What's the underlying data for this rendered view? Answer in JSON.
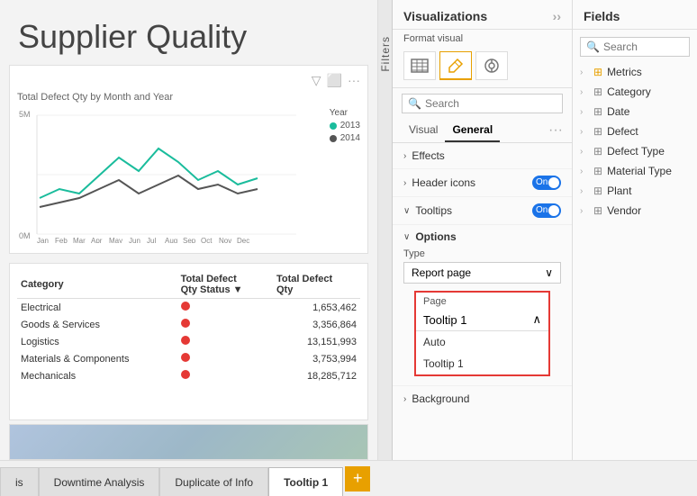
{
  "title": "Supplier Quality",
  "chart": {
    "title": "Total Defect Qty by Month and Year",
    "yAxisMax": "5M",
    "yAxisMin": "0M",
    "legend": {
      "label": "Year",
      "items": [
        {
          "year": "2013",
          "color": "#1abc9c"
        },
        {
          "year": "2014",
          "color": "#555555"
        }
      ]
    },
    "xLabels": [
      "Jan",
      "Feb",
      "Mar",
      "Apr",
      "May",
      "Jun",
      "Jul",
      "Aug",
      "Sep",
      "Oct",
      "Nov",
      "Dec"
    ]
  },
  "table": {
    "headers": [
      "Category",
      "Total Defect\nQty Status",
      "Total Defect\nQty"
    ],
    "rows": [
      {
        "category": "Electrical",
        "qty": "1,653,462"
      },
      {
        "category": "Goods & Services",
        "qty": "3,356,864"
      },
      {
        "category": "Logistics",
        "qty": "13,151,993"
      },
      {
        "category": "Materials & Components",
        "qty": "3,753,994"
      },
      {
        "category": "Mechanicals",
        "qty": "18,285,712"
      }
    ]
  },
  "filter_sidebar": {
    "label": "Filters"
  },
  "viz_panel": {
    "title": "Visualizations",
    "format_visual": "Format visual",
    "search_placeholder": "Search",
    "tabs": [
      {
        "label": "Visual",
        "active": false
      },
      {
        "label": "General",
        "active": true
      }
    ],
    "sections": [
      {
        "label": "Effects",
        "expanded": false,
        "chevron": "›"
      },
      {
        "label": "Header icons",
        "expanded": false,
        "chevron": "›",
        "toggle": "On"
      },
      {
        "label": "Tooltips",
        "expanded": true,
        "chevron": "∨",
        "toggle": "On"
      },
      {
        "label": "Options",
        "expanded": true,
        "chevron": "∨"
      },
      {
        "label": "Background",
        "expanded": false,
        "chevron": "›"
      }
    ],
    "tooltips": {
      "type_label": "Type",
      "type_value": "Report page",
      "page_label": "Page",
      "page_value": "Tooltip 1",
      "page_options": [
        "Auto",
        "Tooltip 1"
      ]
    }
  },
  "fields_panel": {
    "title": "Fields",
    "search_placeholder": "Search",
    "items": [
      {
        "label": "Metrics",
        "icon": "metrics",
        "expandable": true
      },
      {
        "label": "Category",
        "icon": "table",
        "expandable": true
      },
      {
        "label": "Date",
        "icon": "table",
        "expandable": true
      },
      {
        "label": "Defect",
        "icon": "table",
        "expandable": true
      },
      {
        "label": "Defect Type",
        "icon": "table",
        "expandable": true
      },
      {
        "label": "Material Type",
        "icon": "table",
        "expandable": true
      },
      {
        "label": "Plant",
        "icon": "table",
        "expandable": true
      },
      {
        "label": "Vendor",
        "icon": "table",
        "expandable": true
      }
    ]
  },
  "bottom_tabs": [
    {
      "label": "is",
      "active": false
    },
    {
      "label": "Downtime Analysis",
      "active": false
    },
    {
      "label": "Duplicate of Info",
      "active": false
    },
    {
      "label": "Tooltip 1",
      "active": true
    }
  ],
  "add_tab_label": "+"
}
